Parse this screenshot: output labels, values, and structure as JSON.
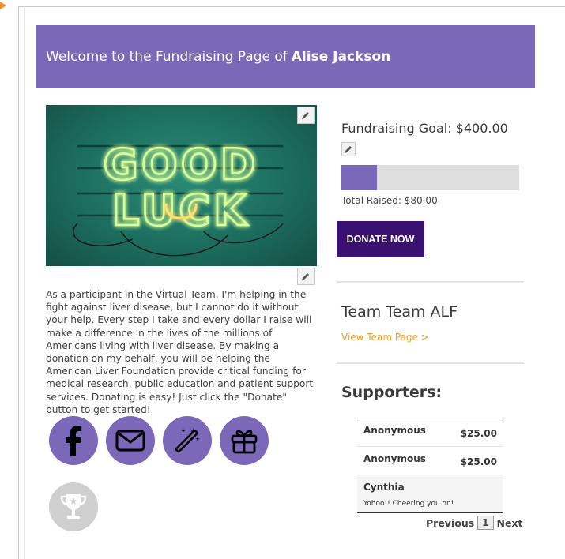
{
  "banner": {
    "prefix": "Welcome to the Fundraising Page of",
    "name": "Alise Jackson"
  },
  "hero": {
    "image_desc": "good-luck-neon-sign",
    "lettering_top": "GOOD",
    "lettering_bottom": "LUCK"
  },
  "story": {
    "text": "As a participant in the Virtual Team, I'm helping in the fight against liver disease, but I cannot do it without your help. Every step I take and every dollar I raise will make a difference in the lives of the millions of Americans living with liver disease. By making a donation on my behalf, you will be helping the American Liver Foundation provide critical funding for medical research, public education and patient support services. Donating is easy! Just click the \"Donate\" button to get started!"
  },
  "social": {
    "icons": [
      "facebook-icon",
      "email-icon",
      "magic-wand-icon",
      "gift-icon"
    ],
    "trophy_icon": "trophy-icon"
  },
  "fundraising": {
    "goal_label": "Fundraising Goal: $400.00",
    "raised_label": "Total Raised: $80.00",
    "progress_fraction": 0.2,
    "donate_label": "DONATE NOW"
  },
  "team": {
    "name": "Team Team ALF",
    "link": "View Team Page >"
  },
  "supporters": {
    "title": "Supporters:",
    "rows": [
      {
        "name": "Anonymous",
        "amount": "$25.00",
        "message": ""
      },
      {
        "name": "Anonymous",
        "amount": "$25.00",
        "message": ""
      },
      {
        "name": "Cynthia",
        "amount": "",
        "message": "Yohoo!! Cheering you on!"
      }
    ]
  },
  "pager": {
    "previous": "Previous",
    "current": "1",
    "next": "Next"
  },
  "colors": {
    "brand_purple": "#7b68b8",
    "donate_purple": "#3a1070",
    "link_orange": "#f0a028"
  }
}
